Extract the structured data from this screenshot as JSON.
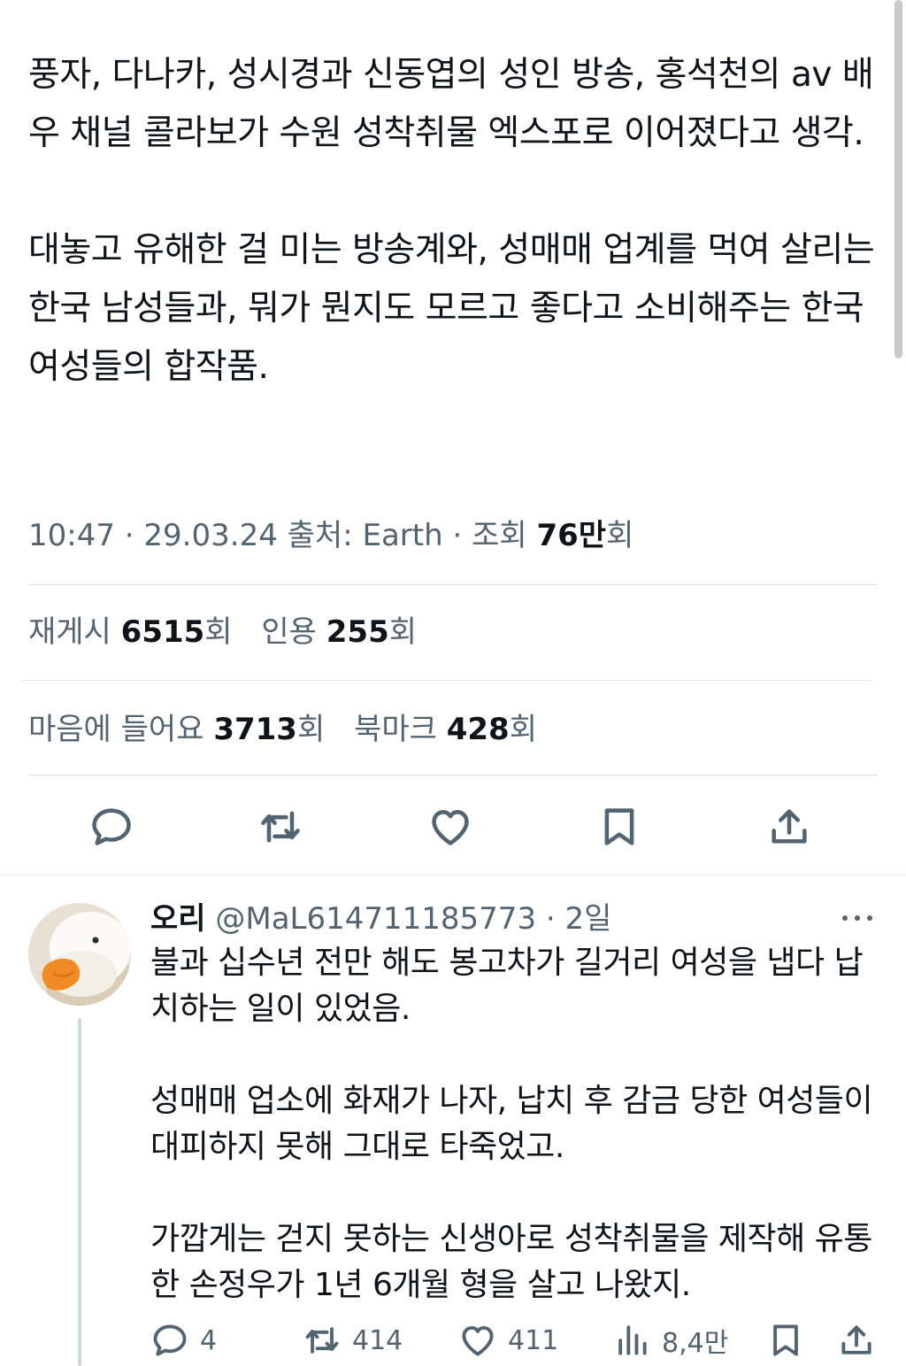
{
  "tweet": {
    "paragraphs": [
      "풍자, 다나카, 성시경과 신동엽의 성인 방송, 홍석천의 av 배우 채널 콜라보가 수원 성착취물 엑스포로 이어졌다고 생각.",
      "대놓고 유해한 걸 미는 방송계와, 성매매 업계를 먹여 살리는 한국 남성들과, 뭐가 뭔지도 모르고 좋다고 소비해주는 한국 여성들의 합작품."
    ],
    "time": "10:47",
    "date": "29.03.24",
    "source_label": "출처:",
    "source": "Earth",
    "views_label": "조회",
    "views": "76만",
    "unit": "회"
  },
  "stats": {
    "reposts_label": "재게시",
    "reposts": "6515",
    "quotes_label": "인용",
    "quotes": "255",
    "likes_label": "마음에 들어요",
    "likes": "3713",
    "bookmarks_label": "북마크",
    "bookmarks": "428",
    "unit": "회"
  },
  "actions": [
    "reply-icon",
    "repost-icon",
    "like-icon",
    "bookmark-icon",
    "share-icon"
  ],
  "reply": {
    "name": "오리",
    "handle": "@MaL614711185773",
    "separator": "·",
    "time": "2일",
    "paragraphs": [
      "불과 십수년 전만 해도 봉고차가 길거리 여성을 냅다 납치하는 일이 있었음.",
      "성매매 업소에 화재가 나자, 납치 후 감금 당한 여성들이 대피하지 못해 그대로 타죽었고.",
      "가깝게는 걷지 못하는 신생아로 성착취물을 제작해 유통한 손정우가 1년 6개월 형을 살고 나왔지."
    ],
    "counts": {
      "replies": "4",
      "reposts": "414",
      "likes": "411",
      "views": "8,4만"
    }
  },
  "colors": {
    "text": "#0f1419",
    "secondary": "#536471",
    "divider": "#e1e5e8",
    "thread": "#cfd9de"
  }
}
